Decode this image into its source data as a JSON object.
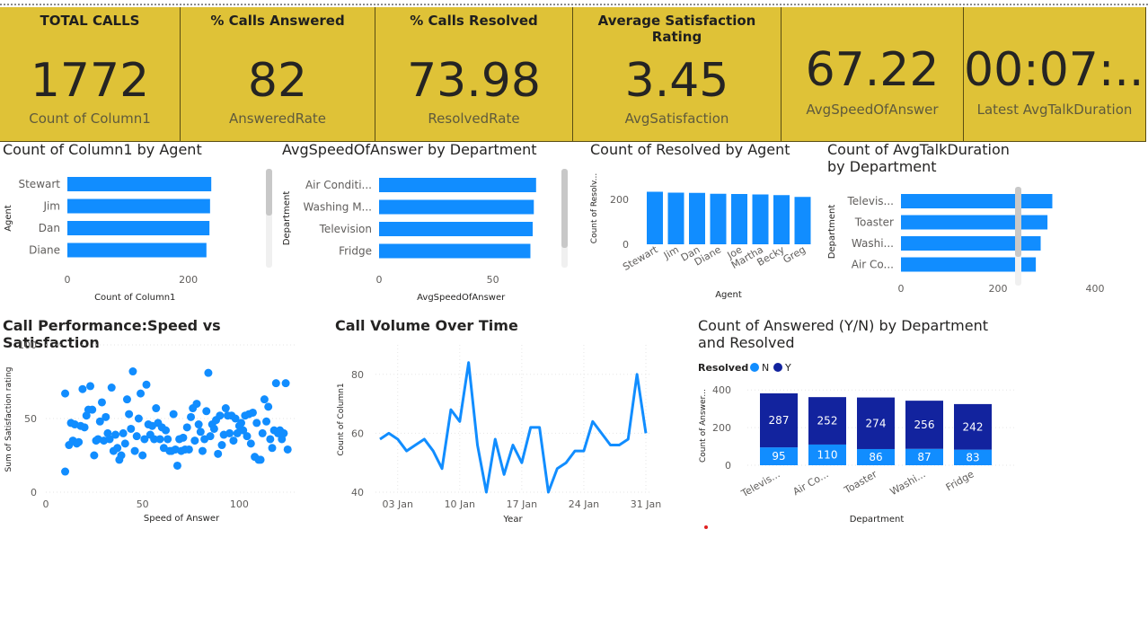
{
  "cards": [
    {
      "title": "TOTAL CALLS",
      "value": "1772",
      "label": "Count of Column1"
    },
    {
      "title": "% Calls Answered",
      "value": "82",
      "label": "AnsweredRate"
    },
    {
      "title": "% Calls Resolved",
      "value": "73.98",
      "label": "ResolvedRate"
    },
    {
      "title": "Average Satisfaction Rating",
      "value": "3.45",
      "label": "AvgSatisfaction"
    },
    {
      "title": "",
      "value": "67.22",
      "label": "AvgSpeedOfAnswer"
    },
    {
      "title": "",
      "value": "00:07:...",
      "label": "Latest AvgTalkDuration"
    }
  ],
  "colors": {
    "card_bg": "#dfc237",
    "bar": "#118dff",
    "dark": "#12239e",
    "axis_text": "#605e5c"
  },
  "chart_data": [
    {
      "type": "bar",
      "title": "Count of Column1 by Agent",
      "orientation": "horizontal",
      "categories": [
        "Stewart",
        "Jim",
        "Dan",
        "Diane"
      ],
      "values": [
        238,
        236,
        235,
        230
      ],
      "xlabel": "Count of Column1",
      "ylabel": "Agent",
      "xlim": [
        0,
        260
      ],
      "ticks": [
        "0",
        "200"
      ],
      "grid": false
    },
    {
      "type": "bar",
      "title": "AvgSpeedOfAnswer by Department",
      "orientation": "horizontal",
      "categories": [
        "Air Conditi...",
        "Washing M...",
        "Television",
        "Fridge"
      ],
      "values": [
        69,
        68,
        67.5,
        66.5
      ],
      "xlabel": "AvgSpeedOfAnswer",
      "ylabel": "Department",
      "xlim": [
        0,
        75
      ],
      "ticks": [
        "0",
        "50"
      ],
      "grid": false
    },
    {
      "type": "bar",
      "title": "Count of Resolved by Agent",
      "orientation": "vertical",
      "categories": [
        "Stewart",
        "Jim",
        "Dan",
        "Diane",
        "Joe",
        "Martha",
        "Becky",
        "Greg"
      ],
      "values": [
        234,
        230,
        229,
        225,
        224,
        222,
        219,
        211
      ],
      "xlabel": "Agent",
      "ylabel": "Count of Resolv...",
      "ylim": [
        0,
        260
      ],
      "ticks": [
        "0",
        "200"
      ],
      "grid": false
    },
    {
      "type": "bar",
      "title": "Count of AvgTalkDuration by Department",
      "orientation": "horizontal",
      "categories": [
        "Televis...",
        "Toaster",
        "Washi...",
        "Air Co..."
      ],
      "values": [
        312,
        302,
        288,
        278
      ],
      "xlabel": "",
      "ylabel": "Department",
      "xlim": [
        0,
        450
      ],
      "ticks": [
        "0",
        "200",
        "400"
      ],
      "grid": false
    },
    {
      "type": "scatter",
      "title": "Call Performance:Speed vs Satisfaction",
      "xlabel": "Speed of Answer",
      "ylabel": "Sum of Satisfaction rating",
      "xlim": [
        0,
        130
      ],
      "ylim": [
        0,
        100
      ],
      "xticks": [
        "0",
        "50",
        "100"
      ],
      "yticks": [
        "0",
        "50",
        "100"
      ],
      "points": [
        [
          10,
          67
        ],
        [
          10,
          14
        ],
        [
          12,
          32
        ],
        [
          13,
          47
        ],
        [
          14,
          35
        ],
        [
          15,
          46
        ],
        [
          16,
          33
        ],
        [
          17,
          34
        ],
        [
          18,
          45
        ],
        [
          19,
          70
        ],
        [
          20,
          44
        ],
        [
          21,
          52
        ],
        [
          22,
          56
        ],
        [
          23,
          72
        ],
        [
          24,
          56
        ],
        [
          25,
          25
        ],
        [
          26,
          35
        ],
        [
          27,
          36
        ],
        [
          28,
          48
        ],
        [
          29,
          61
        ],
        [
          30,
          35
        ],
        [
          31,
          51
        ],
        [
          32,
          40
        ],
        [
          33,
          36
        ],
        [
          34,
          71
        ],
        [
          35,
          28
        ],
        [
          36,
          39
        ],
        [
          37,
          30
        ],
        [
          38,
          22
        ],
        [
          39,
          25
        ],
        [
          40,
          40
        ],
        [
          41,
          33
        ],
        [
          42,
          63
        ],
        [
          43,
          53
        ],
        [
          44,
          43
        ],
        [
          45,
          82
        ],
        [
          46,
          28
        ],
        [
          47,
          38
        ],
        [
          48,
          50
        ],
        [
          49,
          67
        ],
        [
          50,
          25
        ],
        [
          51,
          36
        ],
        [
          52,
          73
        ],
        [
          53,
          46
        ],
        [
          54,
          39
        ],
        [
          55,
          45
        ],
        [
          56,
          36
        ],
        [
          57,
          57
        ],
        [
          58,
          47
        ],
        [
          59,
          36
        ],
        [
          60,
          44
        ],
        [
          61,
          30
        ],
        [
          62,
          42
        ],
        [
          63,
          36
        ],
        [
          64,
          28
        ],
        [
          65,
          28
        ],
        [
          66,
          53
        ],
        [
          67,
          29
        ],
        [
          68,
          18
        ],
        [
          69,
          36
        ],
        [
          70,
          28
        ],
        [
          71,
          37
        ],
        [
          72,
          29
        ],
        [
          73,
          44
        ],
        [
          74,
          29
        ],
        [
          75,
          51
        ],
        [
          76,
          57
        ],
        [
          77,
          35
        ],
        [
          78,
          60
        ],
        [
          79,
          46
        ],
        [
          80,
          41
        ],
        [
          81,
          28
        ],
        [
          82,
          36
        ],
        [
          83,
          55
        ],
        [
          84,
          81
        ],
        [
          85,
          38
        ],
        [
          86,
          46
        ],
        [
          87,
          43
        ],
        [
          88,
          49
        ],
        [
          89,
          26
        ],
        [
          90,
          52
        ],
        [
          91,
          32
        ],
        [
          92,
          39
        ],
        [
          93,
          57
        ],
        [
          94,
          52
        ],
        [
          95,
          40
        ],
        [
          96,
          52
        ],
        [
          97,
          35
        ],
        [
          98,
          50
        ],
        [
          99,
          40
        ],
        [
          100,
          45
        ],
        [
          101,
          47
        ],
        [
          102,
          42
        ],
        [
          103,
          52
        ],
        [
          104,
          38
        ],
        [
          105,
          53
        ],
        [
          106,
          33
        ],
        [
          107,
          54
        ],
        [
          108,
          24
        ],
        [
          109,
          47
        ],
        [
          110,
          22
        ],
        [
          111,
          22
        ],
        [
          112,
          40
        ],
        [
          113,
          63
        ],
        [
          114,
          48
        ],
        [
          115,
          58
        ],
        [
          116,
          36
        ],
        [
          117,
          30
        ],
        [
          118,
          42
        ],
        [
          119,
          74
        ],
        [
          120,
          40
        ],
        [
          121,
          42
        ],
        [
          122,
          36
        ],
        [
          123,
          40
        ],
        [
          124,
          74
        ],
        [
          125,
          29
        ]
      ]
    },
    {
      "type": "line",
      "title": "Call Volume Over Time",
      "xlabel": "Year",
      "ylabel": "Count of Column1",
      "xlim": [
        "2021-01-01",
        "2021-01-31"
      ],
      "ylim": [
        40,
        90
      ],
      "xticks": [
        {
          "label": "03 Jan",
          "date": "2021-01-03"
        },
        {
          "label": "10 Jan",
          "date": "2021-01-10"
        },
        {
          "label": "17 Jan",
          "date": "2021-01-17"
        },
        {
          "label": "24 Jan",
          "date": "2021-01-24"
        },
        {
          "label": "31 Jan",
          "date": "2021-01-31"
        }
      ],
      "yticks": [
        "40",
        "60",
        "80"
      ],
      "x": [
        "2021-01-01",
        "2021-01-02",
        "2021-01-03",
        "2021-01-04",
        "2021-01-05",
        "2021-01-06",
        "2021-01-07",
        "2021-01-08",
        "2021-01-09",
        "2021-01-10",
        "2021-01-11",
        "2021-01-12",
        "2021-01-13",
        "2021-01-14",
        "2021-01-15",
        "2021-01-16",
        "2021-01-17",
        "2021-01-18",
        "2021-01-19",
        "2021-01-20",
        "2021-01-21",
        "2021-01-22",
        "2021-01-23",
        "2021-01-24",
        "2021-01-25",
        "2021-01-26",
        "2021-01-27",
        "2021-01-28",
        "2021-01-29",
        "2021-01-30",
        "2021-01-31"
      ],
      "values": [
        58,
        60,
        58,
        54,
        56,
        58,
        54,
        48,
        68,
        64,
        84,
        56,
        40,
        58,
        46,
        56,
        50,
        62,
        62,
        40,
        48,
        50,
        54,
        54,
        64,
        60,
        56,
        56,
        58,
        80,
        60
      ]
    },
    {
      "type": "bar",
      "stacked": true,
      "title": "Count of Answered (Y/N) by Department and Resolved",
      "legend_title": "Resolved",
      "legend_position": "top-left",
      "categories": [
        "Televis...",
        "Air Co...",
        "Toaster",
        "Washi...",
        "Fridge"
      ],
      "series": [
        {
          "name": "N",
          "values": [
            95,
            110,
            86,
            87,
            83
          ],
          "color": "#118dff"
        },
        {
          "name": "Y",
          "values": [
            287,
            252,
            274,
            256,
            242
          ],
          "color": "#12239e"
        }
      ],
      "xlabel": "Department",
      "ylabel": "Count of Answer...",
      "ylim": [
        0,
        420
      ],
      "yticks": [
        "0",
        "200",
        "400"
      ],
      "grid": true
    }
  ]
}
